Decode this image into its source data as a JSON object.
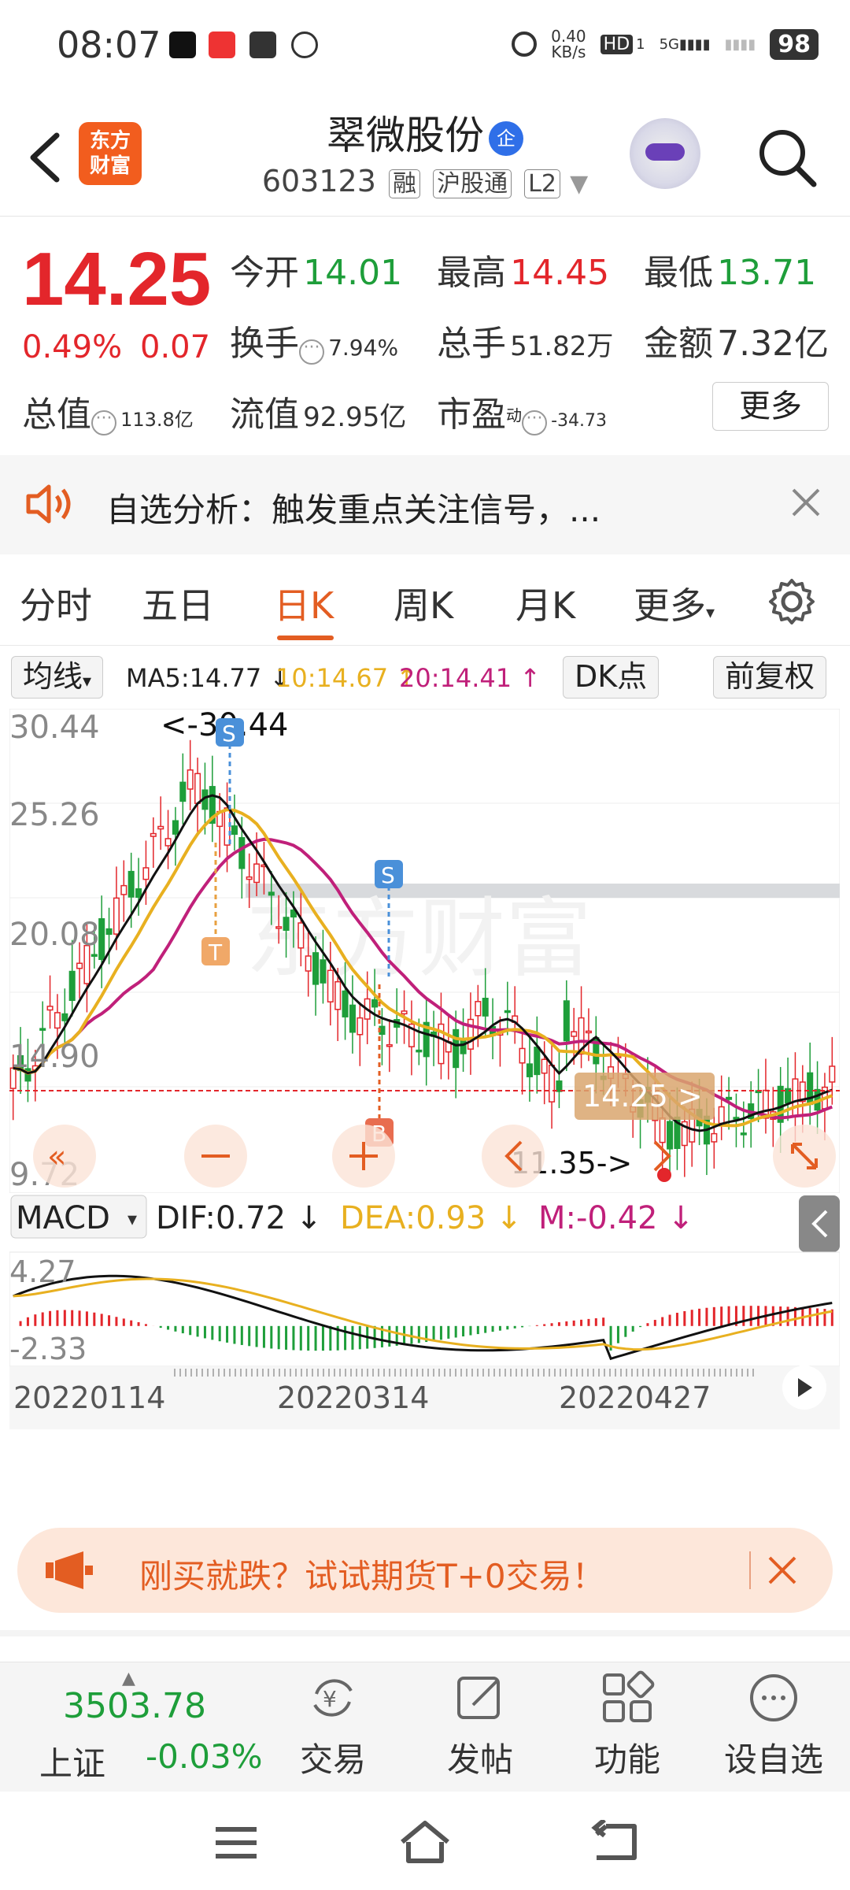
{
  "status": {
    "time": "08:07",
    "net_speed": "0.40\nKB/s",
    "net_speed_top": "0.40",
    "net_speed_bottom": "KB/s",
    "hd": "HD",
    "sim": "1",
    "signal": "5G",
    "battery": "98"
  },
  "header": {
    "title": "翠微股份",
    "badge": "企",
    "code": "603123",
    "tags": [
      "融",
      "沪股通",
      "L2"
    ],
    "logo_line1": "东方",
    "logo_line2": "财富"
  },
  "quote": {
    "price": "14.25",
    "change_pct": "0.49%",
    "change_amt": "0.07",
    "open_label": "今开",
    "open": "14.01",
    "high_label": "最高",
    "high": "14.45",
    "low_label": "最低",
    "low": "13.71",
    "turnover_label": "换手",
    "turnover": "7.94%",
    "volume_label": "总手",
    "volume": "51.82万",
    "amount_label": "金额",
    "amount": "7.32亿",
    "mcap_label": "总值",
    "mcap": "113.8亿",
    "float_label": "流值",
    "float_cap": "92.95亿",
    "pe_label": "市盈",
    "pe_sup": "动",
    "pe": "-34.73",
    "more": "更多"
  },
  "notice": {
    "text": "自选分析：触发重点关注信号，..."
  },
  "tabs": [
    "分时",
    "五日",
    "日K",
    "周K",
    "月K",
    "更多"
  ],
  "active_tab": "日K",
  "ma_bar": {
    "selector": "均线",
    "ma5": "MA5:14.77 ↓",
    "ma10": "10:14.67 ↑",
    "ma20": "20:14.41 ↑",
    "dk": "DK点",
    "adjust": "前复权"
  },
  "chart_labels": {
    "y_top": "30.44",
    "y2": "25.26",
    "y3": "20.08",
    "y4": "14.90",
    "y_bottom": "9.72",
    "max_marker": "<-30.44",
    "min_marker": "11.35->",
    "current_marker": "14.25 >",
    "macd_title": "MACD",
    "dif": "DIF:0.72 ↓",
    "dea": "DEA:0.93 ↓",
    "m": "M:-0.42 ↓",
    "macd_top": "4.27",
    "macd_bottom": "-2.33",
    "dates": [
      "20220114",
      "20220314",
      "20220427"
    ],
    "sig_s1": "S",
    "sig_s2": "S",
    "sig_b": "B",
    "sig_t": "T",
    "watermark": "东方财富"
  },
  "banner": {
    "text": "刚买就跌？试试期货T+0交易！"
  },
  "bottom": {
    "index_value": "3503.78",
    "index_name": "上证",
    "index_change": "-0.03%",
    "nav": [
      "交易",
      "发帖",
      "功能",
      "设自选"
    ]
  },
  "colors": {
    "up": "#e3262b",
    "down": "#1e9e3a",
    "accent": "#e35d22",
    "ma5": "#111111",
    "ma10": "#e8b020",
    "ma20": "#c0207a"
  }
}
